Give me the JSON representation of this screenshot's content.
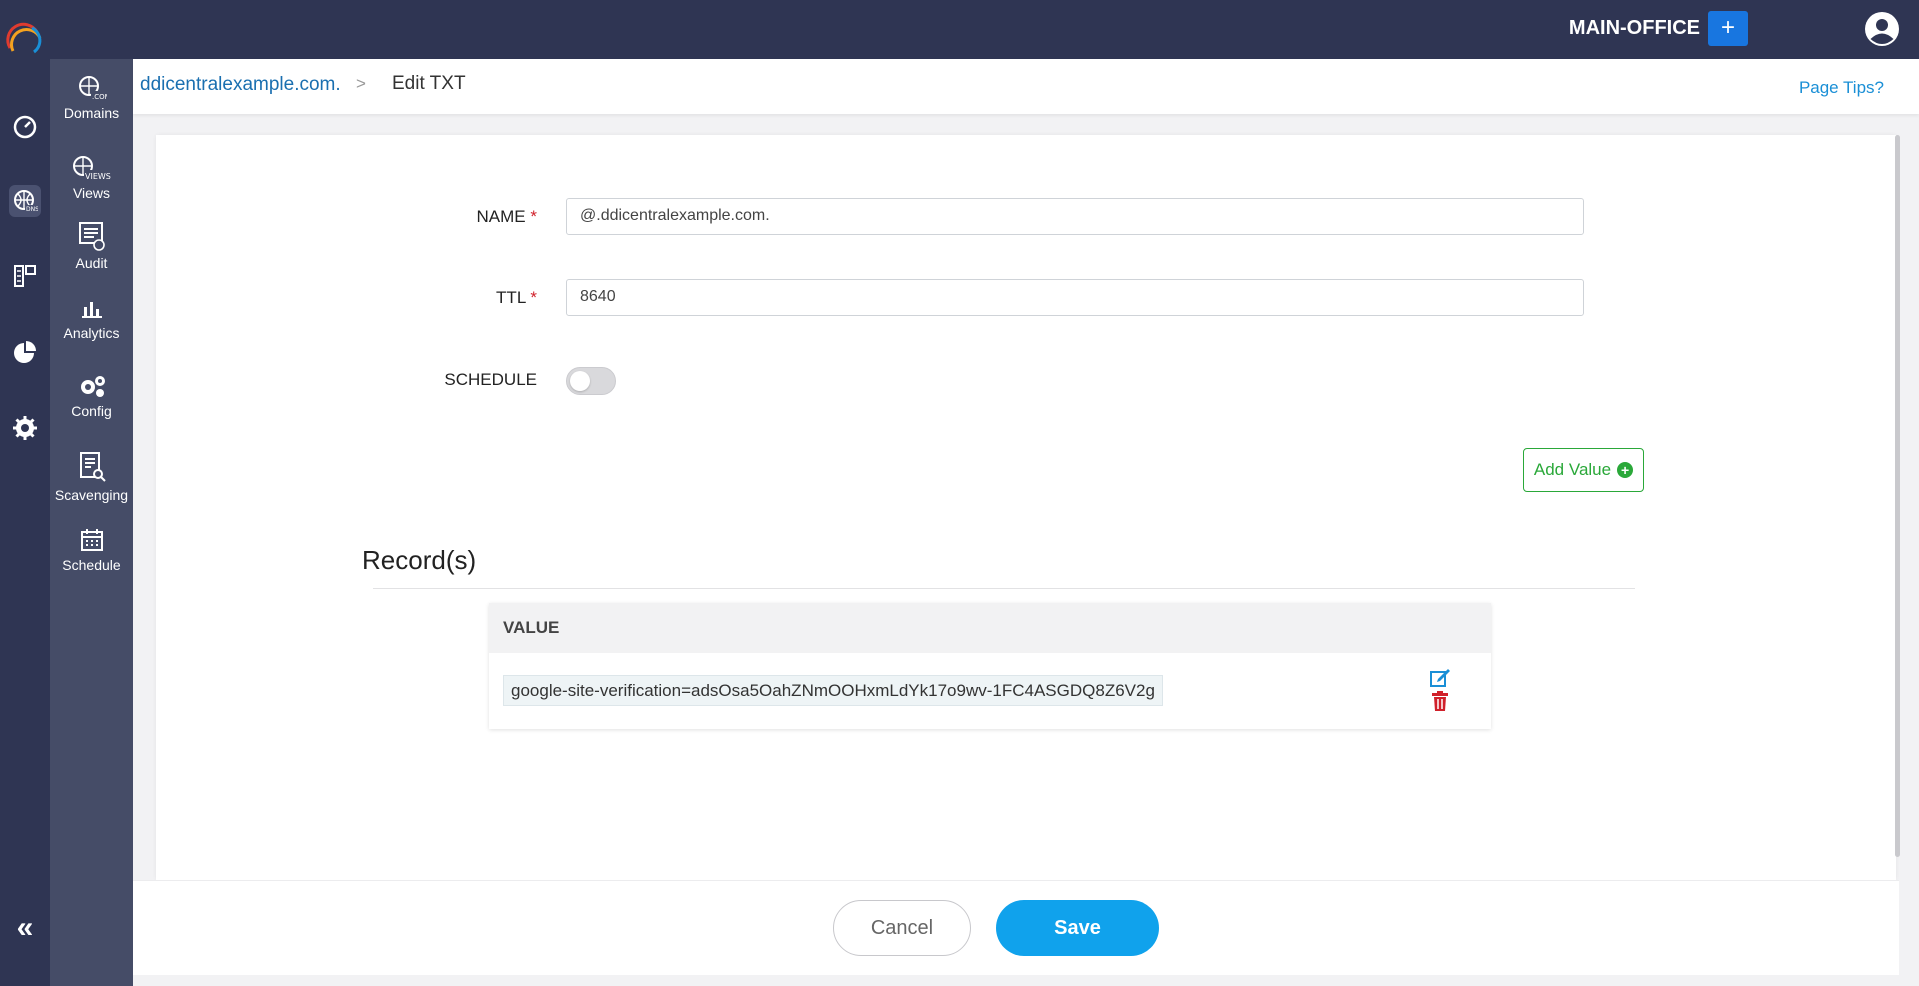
{
  "header": {
    "office": "MAIN-OFFICE",
    "add_label": "+"
  },
  "rail": {
    "collapse_label": "«"
  },
  "subnav": {
    "items": [
      {
        "label": "Domains",
        "icon": "domains-icon"
      },
      {
        "label": "Views",
        "icon": "views-icon"
      },
      {
        "label": "Audit",
        "icon": "audit-icon"
      },
      {
        "label": "Analytics",
        "icon": "analytics-icon"
      },
      {
        "label": "Config",
        "icon": "config-icon"
      },
      {
        "label": "Scavenging",
        "icon": "scavenging-icon"
      },
      {
        "label": "Schedule",
        "icon": "schedule-icon"
      }
    ]
  },
  "breadcrumb": {
    "parent": "ddicentralexample.com.",
    "separator": ">",
    "current": "Edit TXT",
    "tips": "Page Tips?"
  },
  "form": {
    "name_label": "NAME",
    "name_value": "@.ddicentralexample.com.",
    "ttl_label": "TTL",
    "ttl_value": "8640",
    "required_mark": "*",
    "schedule_label": "SCHEDULE",
    "schedule_enabled": false,
    "add_value_label": "Add Value"
  },
  "records": {
    "title": "Record(s)",
    "column": "VALUE",
    "rows": [
      {
        "value": "google-site-verification=adsOsa5OahZNmOOHxmLdYk17o9wv-1FC4ASGDQ8Z6V2g"
      }
    ]
  },
  "footer": {
    "cancel_label": "Cancel",
    "save_label": "Save"
  },
  "colors": {
    "nav_dark": "#2f3553",
    "subnav": "#454c67",
    "accent": "#10a2ec",
    "success": "#2aa839",
    "danger": "#d0202a"
  }
}
